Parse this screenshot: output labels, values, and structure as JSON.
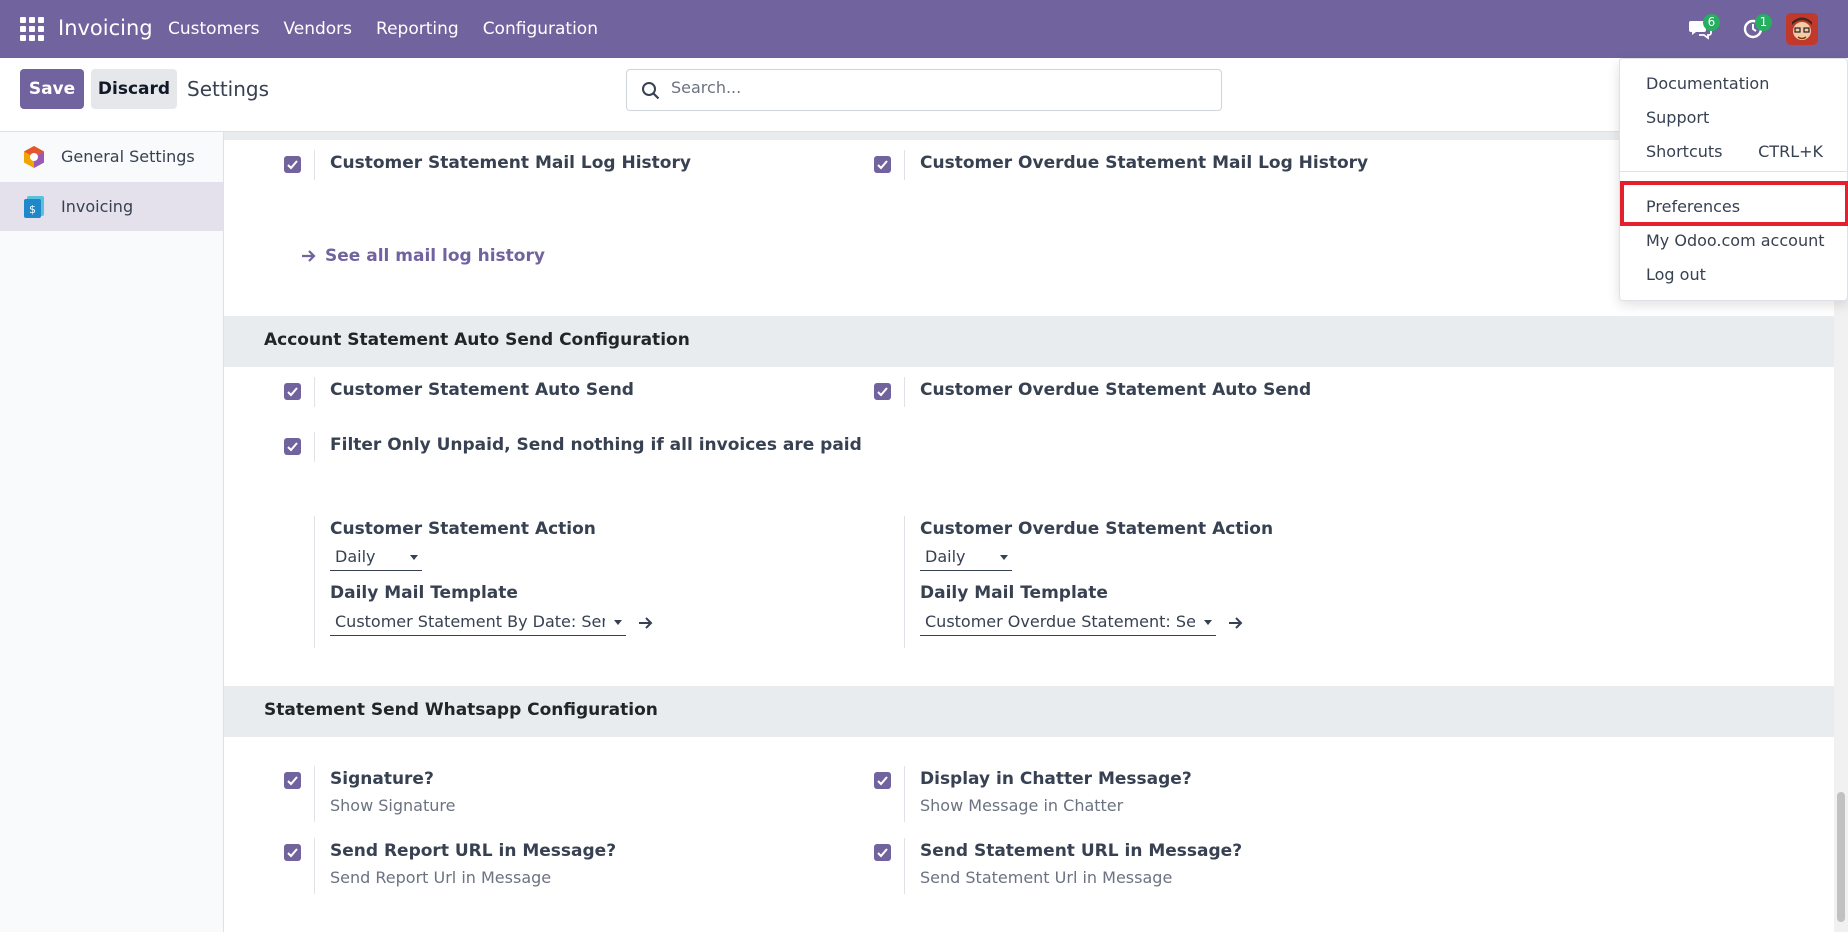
{
  "navbar": {
    "app_name": "Invoicing",
    "menu": [
      "Customers",
      "Vendors",
      "Reporting",
      "Configuration"
    ],
    "messages_count": "6",
    "activities_count": "1",
    "bar_color": "#71639e"
  },
  "control_panel": {
    "save_label": "Save",
    "discard_label": "Discard",
    "title": "Settings",
    "search_placeholder": "Search..."
  },
  "sidebar": {
    "items": [
      {
        "label": "General Settings",
        "icon": "odoo-logo-icon"
      },
      {
        "label": "Invoicing",
        "icon": "invoicing-app-icon",
        "active": true
      }
    ]
  },
  "mail_log": {
    "left_label": "Customer Statement Mail Log History",
    "right_label": "Customer Overdue Statement Mail Log History",
    "link": "See all mail log history"
  },
  "auto_send": {
    "heading": "Account Statement Auto Send Configuration",
    "customer_auto_send": "Customer Statement Auto Send",
    "overdue_auto_send": "Customer Overdue Statement Auto Send",
    "filter_unpaid": "Filter Only Unpaid, Send nothing if all invoices are paid",
    "left": {
      "action_label": "Customer Statement Action",
      "action_value": "Daily",
      "template_label": "Daily Mail Template",
      "template_value": "Customer Statement By Date: Send"
    },
    "right": {
      "action_label": "Customer Overdue Statement Action",
      "action_value": "Daily",
      "template_label": "Daily Mail Template",
      "template_value": "Customer Overdue Statement: Send"
    }
  },
  "whatsapp": {
    "heading": "Statement Send Whatsapp Configuration",
    "signature_label": "Signature?",
    "signature_sub": "Show Signature",
    "chatter_label": "Display in Chatter Message?",
    "chatter_sub": "Show Message in Chatter",
    "report_url_label": "Send Report URL in Message?",
    "report_url_sub": "Send Report Url in Message",
    "statement_url_label": "Send Statement URL in Message?",
    "statement_url_sub": "Send Statement Url in Message"
  },
  "user_menu": {
    "documentation": "Documentation",
    "support": "Support",
    "shortcuts": "Shortcuts",
    "shortcuts_key": "CTRL+K",
    "preferences": "Preferences",
    "account": "My Odoo.com account",
    "logout": "Log out",
    "highlight_color": "#e5202e"
  }
}
